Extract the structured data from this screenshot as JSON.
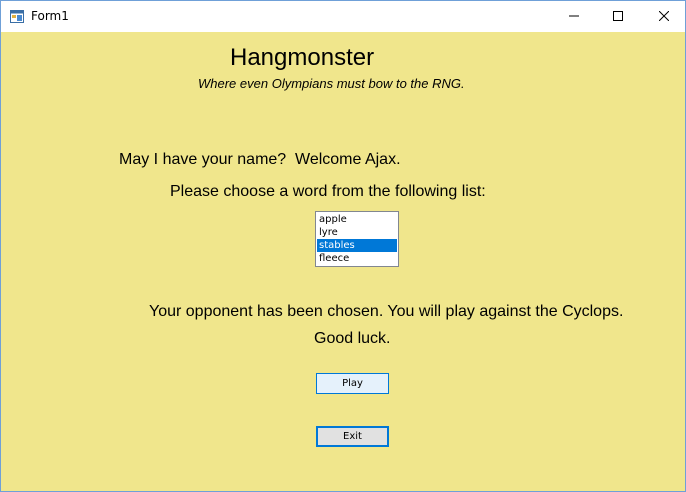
{
  "window": {
    "title": "Form1"
  },
  "header": {
    "title": "Hangmonster",
    "subtitle": "Where even Olympians must bow to the RNG."
  },
  "name_prompt": {
    "label": "May I have your name?",
    "welcome": "Welcome Ajax."
  },
  "word_prompt": {
    "label": "Please choose a word from the following list:",
    "words": [
      "apple",
      "lyre",
      "stables",
      "fleece"
    ],
    "selected": "stables"
  },
  "opponent": {
    "message": "Your opponent has been chosen. You will play against the Cyclops.",
    "luck": "Good luck."
  },
  "buttons": {
    "play_label": "Play",
    "exit_label": "Exit"
  },
  "colors": {
    "background": "#F0E68C",
    "selection": "#0078D7"
  }
}
